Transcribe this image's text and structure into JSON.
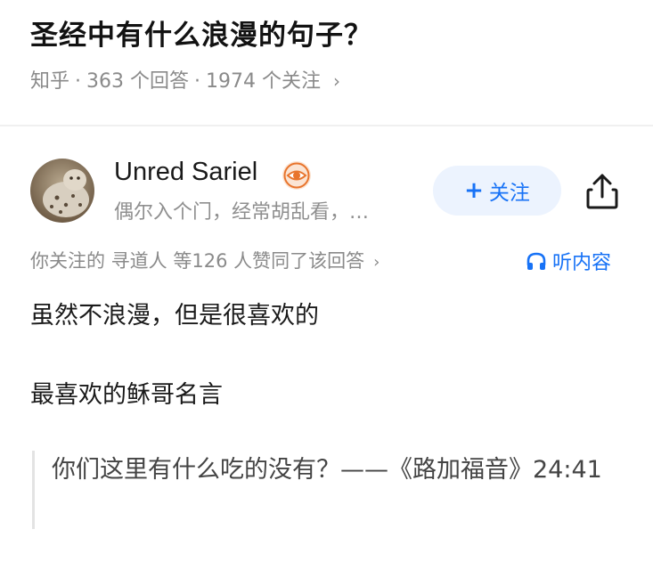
{
  "question": {
    "title": "圣经中有什么浪漫的句子？",
    "source": "知乎",
    "answers_count": "363 个回答",
    "followers_count": "1974 个关注",
    "separator": "·",
    "chevron": "›"
  },
  "author": {
    "name": "Unred Sariel",
    "bio": "偶尔入个门，经常胡乱看，…",
    "follow_plus": "+",
    "follow_label": "关注",
    "avatar_icon": "snow-leopard-avatar",
    "badge_icon": "eye-badge-icon"
  },
  "answer": {
    "upvote_text": "你关注的 寻道人 等126 人赞同了该回答",
    "chevron": "›",
    "listen_label": "听内容",
    "paragraphs": [
      "虽然不浪漫，但是很喜欢的",
      "最喜欢的稣哥名言"
    ],
    "quote": "你们这里有什么吃的没有？——《路加福音》24:41"
  },
  "colors": {
    "accent": "#1772f6",
    "follow_bg": "#ecf3fe",
    "muted": "#8a8a8a",
    "badge": "#e8742c"
  }
}
